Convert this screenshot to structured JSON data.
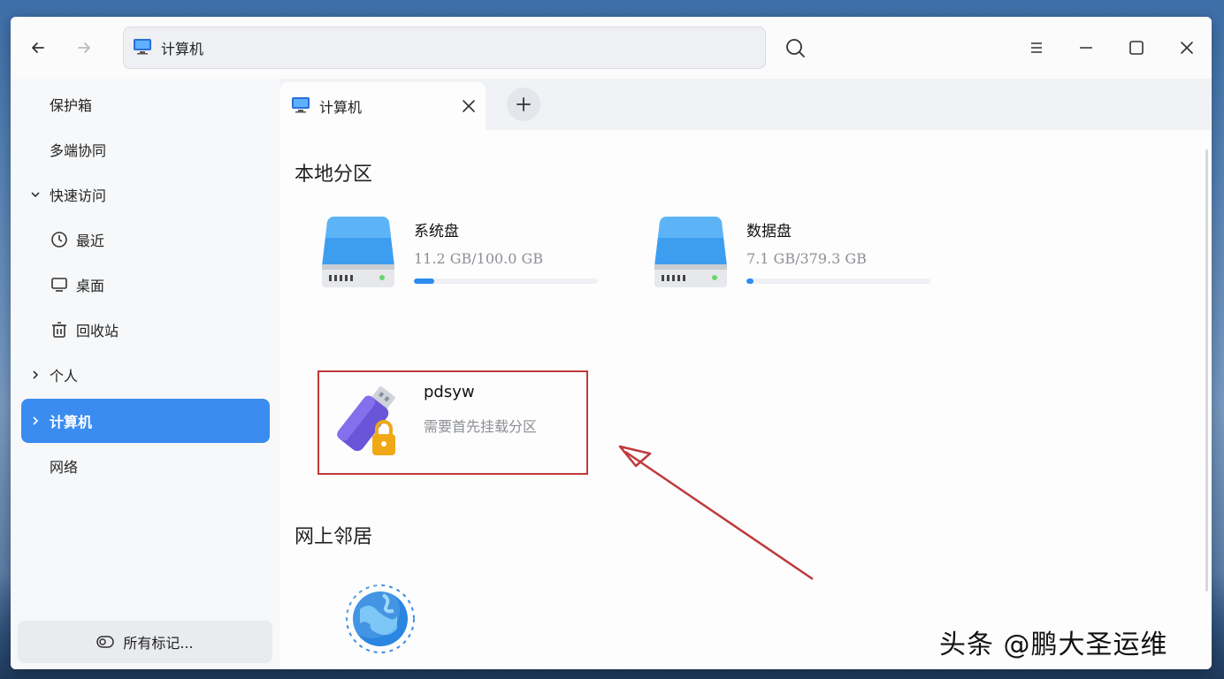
{
  "titlebar": {
    "address": "计算机",
    "icons": [
      "back-arrow-icon",
      "forward-arrow-icon",
      "computer-icon",
      "search-icon",
      "menu-icon",
      "minimize-icon",
      "maximize-icon",
      "close-icon"
    ]
  },
  "sidebar": {
    "items": [
      {
        "label": "保护箱"
      },
      {
        "label": "多端协同"
      },
      {
        "label": "快速访问",
        "expander": "expanded"
      },
      {
        "label": "最近",
        "icon": "clock-icon"
      },
      {
        "label": "桌面",
        "icon": "monitor-icon"
      },
      {
        "label": "回收站",
        "icon": "trash-icon"
      },
      {
        "label": "个人",
        "expander": "collapsed"
      },
      {
        "label": "计算机",
        "expander": "collapsed",
        "active": true
      },
      {
        "label": "网络"
      }
    ],
    "tags_button": "所有标记..."
  },
  "tabs": [
    {
      "label": "计算机"
    }
  ],
  "main": {
    "local_section": "本地分区",
    "drives": [
      {
        "name": "系统盘",
        "size": "11.2 GB/100.0 GB",
        "used_fraction": 0.112
      },
      {
        "name": "数据盘",
        "size": "7.1 GB/379.3 GB",
        "used_fraction": 0.019
      }
    ],
    "usb": {
      "name": "pdsyw",
      "status": "需要首先挂载分区"
    },
    "network_section": "网上邻居"
  },
  "colors": {
    "accent": "#3b8cf0",
    "highlight_box": "#c0393b"
  },
  "watermark": "头条 @鹏大圣运维"
}
